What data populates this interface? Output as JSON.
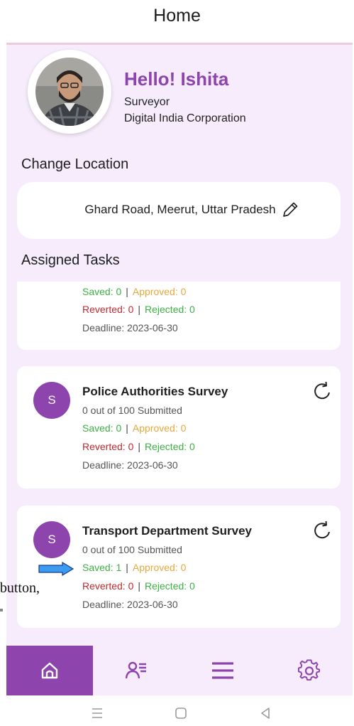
{
  "header": {
    "title": "Home"
  },
  "profile": {
    "greeting": "Hello! Ishita",
    "role": "Surveyor",
    "organization": "Digital India Corporation"
  },
  "location": {
    "section_label": "Change Location",
    "address": "Ghard Road, Meerut, Uttar Pradesh",
    "edit_icon": "pencil-icon"
  },
  "tasks": {
    "section_label": "Assigned Tasks",
    "items": [
      {
        "saved": "Saved: 0",
        "approved": "Approved: 0",
        "reverted": "Reverted: 0",
        "rejected": "Rejected: 0",
        "deadline": "Deadline: 2023-06-30"
      },
      {
        "icon_letter": "S",
        "title": "Police Authorities Survey",
        "submitted": "0 out of 100 Submitted",
        "saved": "Saved: 0",
        "approved": "Approved: 0",
        "reverted": "Reverted: 0",
        "rejected": "Rejected: 0",
        "deadline": "Deadline: 2023-06-30"
      },
      {
        "icon_letter": "S",
        "title": "Transport Department Survey",
        "submitted": "0 out of 100 Submitted",
        "saved": "Saved: 1",
        "approved": "Approved: 0",
        "reverted": "Reverted: 0",
        "rejected": "Rejected: 0",
        "deadline": "Deadline: 2023-06-30"
      }
    ]
  },
  "annotation": {
    "text": "e button,"
  },
  "bottom_nav": {
    "items": [
      {
        "icon": "home-icon",
        "active": true
      },
      {
        "icon": "user-list-icon",
        "active": false
      },
      {
        "icon": "menu-icon",
        "active": false
      },
      {
        "icon": "gear-icon",
        "active": false
      }
    ]
  },
  "system_nav": [
    "recent-apps-icon",
    "home-square-icon",
    "back-icon"
  ],
  "colors": {
    "accent": "#8e44ad",
    "background": "#f6ecfb",
    "saved": "#3cb043",
    "approved": "#e6a93c",
    "reverted": "#c0282e"
  }
}
